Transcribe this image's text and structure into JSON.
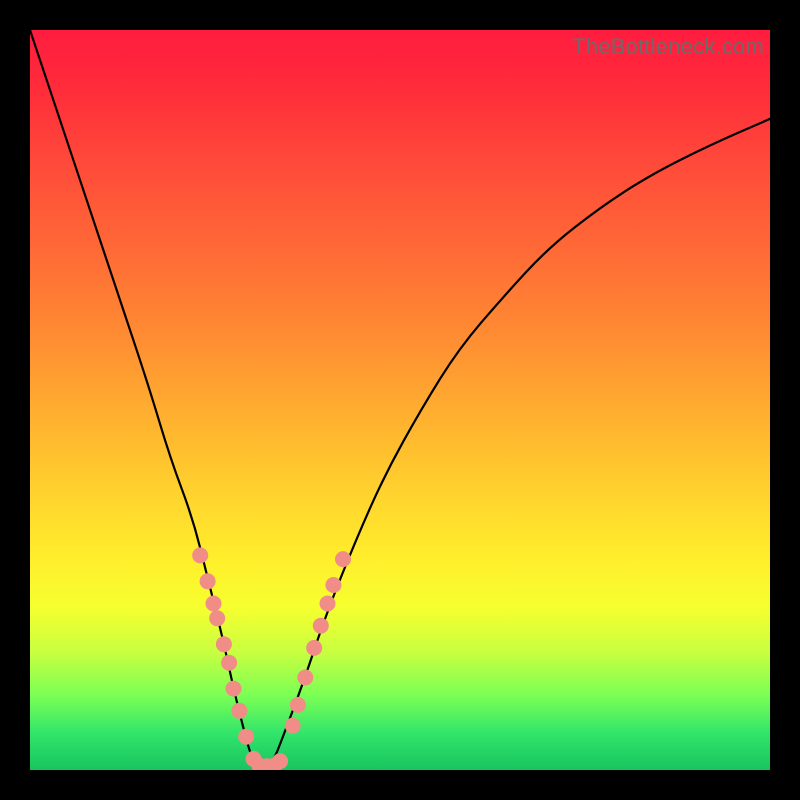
{
  "watermark": "TheBottleneck.com",
  "colors": {
    "background_frame": "#000000",
    "gradient_top": "#ff1c3f",
    "gradient_bottom": "#18c460",
    "curve_stroke": "#000000",
    "marker_fill": "#ef8d86"
  },
  "chart_data": {
    "type": "line",
    "title": "",
    "xlabel": "",
    "ylabel": "",
    "xlim": [
      0,
      100
    ],
    "ylim": [
      0,
      100
    ],
    "grid": false,
    "legend": false,
    "note": "V-shaped bottleneck curve; y is mismatch percentage (0 at valley). x is an implicit hardware-match axis with no ticks shown.",
    "series": [
      {
        "name": "bottleneck-curve",
        "x": [
          0,
          4,
          8,
          12,
          16,
          19,
          22,
          24,
          26,
          27.5,
          29,
          30,
          31,
          32,
          33,
          34,
          37,
          40,
          44,
          48,
          53,
          58,
          64,
          70,
          77,
          84,
          92,
          100
        ],
        "y": [
          100,
          88,
          76,
          64,
          52,
          42,
          34,
          26,
          18,
          11,
          5,
          1.5,
          0.5,
          0.5,
          1.5,
          4,
          12,
          21,
          31,
          40,
          49,
          57,
          64,
          70.5,
          76,
          80.5,
          84.5,
          88
        ]
      }
    ],
    "markers": {
      "name": "highlighted-points",
      "description": "salmon dots clustered near the valley along both arms",
      "points": [
        {
          "x": 23.0,
          "y": 29.0
        },
        {
          "x": 24.0,
          "y": 25.5
        },
        {
          "x": 24.8,
          "y": 22.5
        },
        {
          "x": 25.3,
          "y": 20.5
        },
        {
          "x": 26.2,
          "y": 17.0
        },
        {
          "x": 26.9,
          "y": 14.5
        },
        {
          "x": 27.5,
          "y": 11.0
        },
        {
          "x": 28.3,
          "y": 8.0
        },
        {
          "x": 29.2,
          "y": 4.5
        },
        {
          "x": 30.2,
          "y": 1.5
        },
        {
          "x": 31.0,
          "y": 0.6
        },
        {
          "x": 32.0,
          "y": 0.5
        },
        {
          "x": 33.0,
          "y": 0.6
        },
        {
          "x": 33.8,
          "y": 1.2
        },
        {
          "x": 35.5,
          "y": 6.0
        },
        {
          "x": 36.2,
          "y": 8.8
        },
        {
          "x": 37.2,
          "y": 12.5
        },
        {
          "x": 38.4,
          "y": 16.5
        },
        {
          "x": 39.3,
          "y": 19.5
        },
        {
          "x": 40.2,
          "y": 22.5
        },
        {
          "x": 41.0,
          "y": 25.0
        },
        {
          "x": 42.3,
          "y": 28.5
        }
      ]
    }
  }
}
